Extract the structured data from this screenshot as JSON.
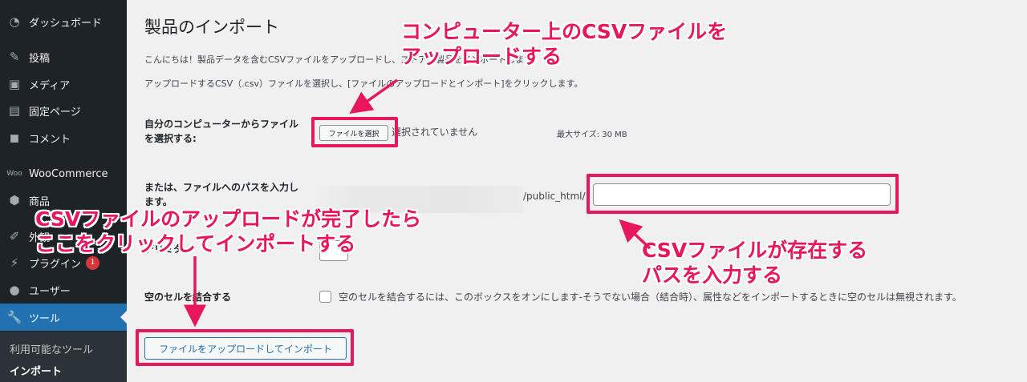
{
  "sidebar": {
    "items": [
      {
        "label": "ダッシュボード",
        "icon": "dashboard-icon"
      },
      {
        "label": "投稿",
        "icon": "pin-icon"
      },
      {
        "label": "メディア",
        "icon": "media-icon"
      },
      {
        "label": "固定ページ",
        "icon": "page-icon"
      },
      {
        "label": "コメント",
        "icon": "comment-icon"
      },
      {
        "label": "WooCommerce",
        "icon": "woocommerce-icon"
      },
      {
        "label": "商品",
        "icon": "box-icon"
      },
      {
        "label": "外観",
        "icon": "brush-icon"
      },
      {
        "label": "プラグイン",
        "icon": "plugin-icon",
        "badge": "1"
      },
      {
        "label": "ユーザー",
        "icon": "user-icon"
      },
      {
        "label": "ツール",
        "icon": "wrench-icon",
        "active": true
      }
    ],
    "submenu": [
      "利用可能なツール",
      "インポート"
    ]
  },
  "page": {
    "title": "製品のインポート",
    "intro": "こんにちは！製品データを含むCSVファイルをアップロードし、ストアに製品をインポートします。",
    "instruction": "アップロードするCSV（.csv）ファイルを選択し、[ファイルのアップロードとインポート]をクリックします。",
    "file_label": "自分のコンピューターからファイルを選択する:",
    "file_button": "ファイルを選択",
    "no_file": "選択されていません",
    "max_size": "最大サイズ: 30 MB",
    "path_label": "または、ファイルへのパスを入力します。",
    "path_suffix": "/public_html/",
    "delimiter_label": "デリミター",
    "merge_label": "空のセルを結合する",
    "merge_desc": "空のセルを結合するには、このボックスをオンにします-そうでない場合（結合時）、属性などをインポートするときに空のセルは無視されます。",
    "submit": "ファイルをアップロードしてインポート"
  },
  "annotations": {
    "note_upload": [
      "コンピューター上のCSVファイルを",
      "アップロードする"
    ],
    "note_click": [
      "CSVファイルのアップロードが完了したら",
      "ここをクリックしてインポートする"
    ],
    "note_path": [
      "CSVファイルが存在する",
      "パスを入力する"
    ],
    "accent_color": "#e8175d"
  },
  "colors": {
    "sidebar_bg": "#1d2327",
    "active_bg": "#2271b1",
    "content_bg": "#f0f0f1"
  }
}
